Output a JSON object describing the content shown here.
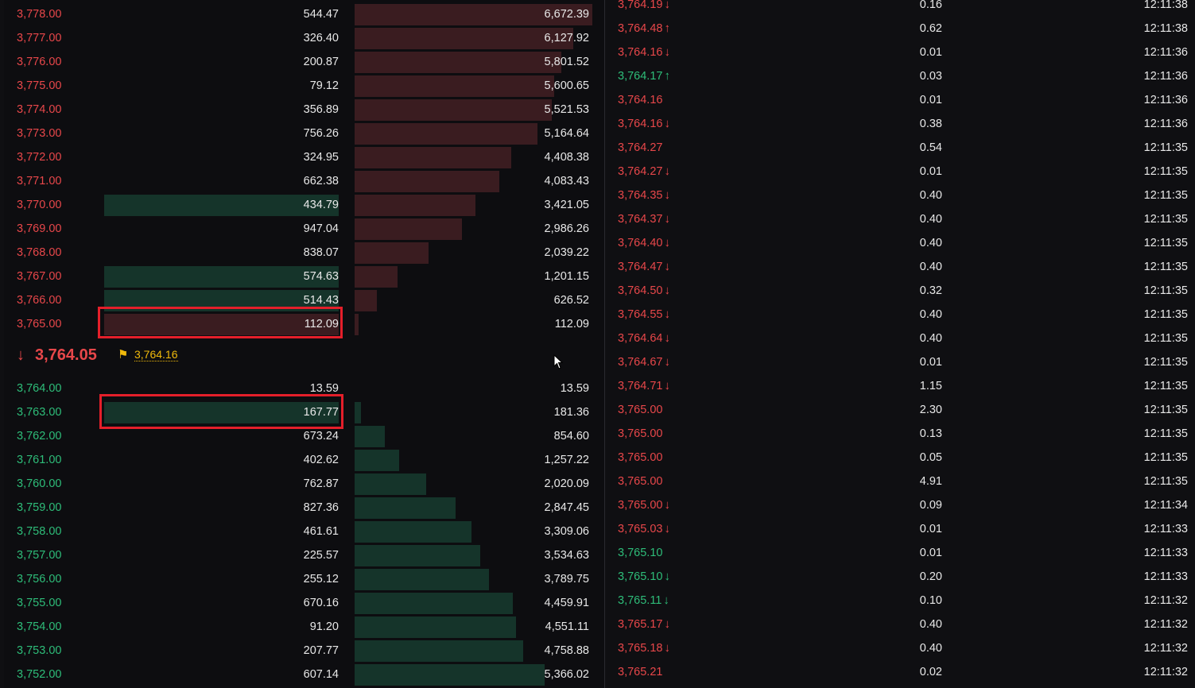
{
  "order_book": {
    "asks": [
      {
        "price": "3,778.00",
        "amount": "544.47",
        "total": "6,672.39",
        "amount_depth": 0,
        "total_depth": 1.0
      },
      {
        "price": "3,777.00",
        "amount": "326.40",
        "total": "6,127.92",
        "amount_depth": 0,
        "total_depth": 0.92
      },
      {
        "price": "3,776.00",
        "amount": "200.87",
        "total": "5,801.52",
        "amount_depth": 0,
        "total_depth": 0.87
      },
      {
        "price": "3,775.00",
        "amount": "79.12",
        "total": "5,600.65",
        "amount_depth": 0,
        "total_depth": 0.84
      },
      {
        "price": "3,774.00",
        "amount": "356.89",
        "total": "5,521.53",
        "amount_depth": 0,
        "total_depth": 0.83
      },
      {
        "price": "3,773.00",
        "amount": "756.26",
        "total": "5,164.64",
        "amount_depth": 0,
        "total_depth": 0.77
      },
      {
        "price": "3,772.00",
        "amount": "324.95",
        "total": "4,408.38",
        "amount_depth": 0,
        "total_depth": 0.66
      },
      {
        "price": "3,771.00",
        "amount": "662.38",
        "total": "4,083.43",
        "amount_depth": 0,
        "total_depth": 0.61
      },
      {
        "price": "3,770.00",
        "amount": "434.79",
        "total": "3,421.05",
        "amount_depth": 1.0,
        "amount_side": "bid",
        "total_depth": 0.51
      },
      {
        "price": "3,769.00",
        "amount": "947.04",
        "total": "2,986.26",
        "amount_depth": 0,
        "total_depth": 0.45
      },
      {
        "price": "3,768.00",
        "amount": "838.07",
        "total": "2,039.22",
        "amount_depth": 0,
        "total_depth": 0.31
      },
      {
        "price": "3,767.00",
        "amount": "574.63",
        "total": "1,201.15",
        "amount_depth": 1.0,
        "amount_side": "bid",
        "total_depth": 0.18
      },
      {
        "price": "3,766.00",
        "amount": "514.43",
        "total": "626.52",
        "amount_depth": 1.0,
        "amount_side": "bid",
        "total_depth": 0.094
      },
      {
        "price": "3,765.00",
        "amount": "112.09",
        "total": "112.09",
        "amount_depth": 1.0,
        "amount_side": "ask",
        "total_depth": 0.017
      }
    ],
    "last_price": {
      "arrow": "↓",
      "value": "3,764.05"
    },
    "mark_price": {
      "icon": "flag-icon",
      "value": "3,764.16"
    },
    "bids": [
      {
        "price": "3,764.00",
        "amount": "13.59",
        "total": "13.59",
        "amount_depth": 0,
        "total_depth": 0
      },
      {
        "price": "3,763.00",
        "amount": "167.77",
        "total": "181.36",
        "amount_depth": 1.0,
        "amount_side": "bid",
        "total_depth": 0.027
      },
      {
        "price": "3,762.00",
        "amount": "673.24",
        "total": "854.60",
        "amount_depth": 0,
        "total_depth": 0.127
      },
      {
        "price": "3,761.00",
        "amount": "402.62",
        "total": "1,257.22",
        "amount_depth": 0,
        "total_depth": 0.187
      },
      {
        "price": "3,760.00",
        "amount": "762.87",
        "total": "2,020.09",
        "amount_depth": 0,
        "total_depth": 0.301
      },
      {
        "price": "3,759.00",
        "amount": "827.36",
        "total": "2,847.45",
        "amount_depth": 0,
        "total_depth": 0.425
      },
      {
        "price": "3,758.00",
        "amount": "461.61",
        "total": "3,309.06",
        "amount_depth": 0,
        "total_depth": 0.493
      },
      {
        "price": "3,757.00",
        "amount": "225.57",
        "total": "3,534.63",
        "amount_depth": 0,
        "total_depth": 0.527
      },
      {
        "price": "3,756.00",
        "amount": "255.12",
        "total": "3,789.75",
        "amount_depth": 0,
        "total_depth": 0.565
      },
      {
        "price": "3,755.00",
        "amount": "670.16",
        "total": "4,459.91",
        "amount_depth": 0,
        "total_depth": 0.665
      },
      {
        "price": "3,754.00",
        "amount": "91.20",
        "total": "4,551.11",
        "amount_depth": 0,
        "total_depth": 0.678
      },
      {
        "price": "3,753.00",
        "amount": "207.77",
        "total": "4,758.88",
        "amount_depth": 0,
        "total_depth": 0.709
      },
      {
        "price": "3,752.00",
        "amount": "607.14",
        "total": "5,366.02",
        "amount_depth": 0,
        "total_depth": 0.8
      }
    ],
    "highlighted": [
      "3,765.00",
      "3,763.00"
    ]
  },
  "trades": [
    {
      "price": "3,764.19",
      "dir": "down",
      "amount": "0.16",
      "time": "12:11:38",
      "side": "sell"
    },
    {
      "price": "3,764.48",
      "dir": "up",
      "amount": "0.62",
      "time": "12:11:38",
      "side": "sell"
    },
    {
      "price": "3,764.16",
      "dir": "down",
      "amount": "0.01",
      "time": "12:11:36",
      "side": "sell"
    },
    {
      "price": "3,764.17",
      "dir": "up",
      "amount": "0.03",
      "time": "12:11:36",
      "side": "buy"
    },
    {
      "price": "3,764.16",
      "dir": "",
      "amount": "0.01",
      "time": "12:11:36",
      "side": "sell"
    },
    {
      "price": "3,764.16",
      "dir": "down",
      "amount": "0.38",
      "time": "12:11:36",
      "side": "sell"
    },
    {
      "price": "3,764.27",
      "dir": "",
      "amount": "0.54",
      "time": "12:11:35",
      "side": "sell"
    },
    {
      "price": "3,764.27",
      "dir": "down",
      "amount": "0.01",
      "time": "12:11:35",
      "side": "sell"
    },
    {
      "price": "3,764.35",
      "dir": "down",
      "amount": "0.40",
      "time": "12:11:35",
      "side": "sell"
    },
    {
      "price": "3,764.37",
      "dir": "down",
      "amount": "0.40",
      "time": "12:11:35",
      "side": "sell"
    },
    {
      "price": "3,764.40",
      "dir": "down",
      "amount": "0.40",
      "time": "12:11:35",
      "side": "sell"
    },
    {
      "price": "3,764.47",
      "dir": "down",
      "amount": "0.40",
      "time": "12:11:35",
      "side": "sell"
    },
    {
      "price": "3,764.50",
      "dir": "down",
      "amount": "0.32",
      "time": "12:11:35",
      "side": "sell"
    },
    {
      "price": "3,764.55",
      "dir": "down",
      "amount": "0.40",
      "time": "12:11:35",
      "side": "sell"
    },
    {
      "price": "3,764.64",
      "dir": "down",
      "amount": "0.40",
      "time": "12:11:35",
      "side": "sell"
    },
    {
      "price": "3,764.67",
      "dir": "down",
      "amount": "0.01",
      "time": "12:11:35",
      "side": "sell"
    },
    {
      "price": "3,764.71",
      "dir": "down",
      "amount": "1.15",
      "time": "12:11:35",
      "side": "sell"
    },
    {
      "price": "3,765.00",
      "dir": "",
      "amount": "2.30",
      "time": "12:11:35",
      "side": "sell"
    },
    {
      "price": "3,765.00",
      "dir": "",
      "amount": "0.13",
      "time": "12:11:35",
      "side": "sell"
    },
    {
      "price": "3,765.00",
      "dir": "",
      "amount": "0.05",
      "time": "12:11:35",
      "side": "sell"
    },
    {
      "price": "3,765.00",
      "dir": "",
      "amount": "4.91",
      "time": "12:11:35",
      "side": "sell"
    },
    {
      "price": "3,765.00",
      "dir": "down",
      "amount": "0.09",
      "time": "12:11:34",
      "side": "sell"
    },
    {
      "price": "3,765.03",
      "dir": "down",
      "amount": "0.01",
      "time": "12:11:33",
      "side": "sell"
    },
    {
      "price": "3,765.10",
      "dir": "",
      "amount": "0.01",
      "time": "12:11:33",
      "side": "buy"
    },
    {
      "price": "3,765.10",
      "dir": "down",
      "amount": "0.20",
      "time": "12:11:33",
      "side": "buy"
    },
    {
      "price": "3,765.11",
      "dir": "down",
      "amount": "0.10",
      "time": "12:11:32",
      "side": "buy"
    },
    {
      "price": "3,765.17",
      "dir": "down",
      "amount": "0.40",
      "time": "12:11:32",
      "side": "sell"
    },
    {
      "price": "3,765.18",
      "dir": "down",
      "amount": "0.40",
      "time": "12:11:32",
      "side": "sell"
    },
    {
      "price": "3,765.21",
      "dir": "",
      "amount": "0.02",
      "time": "12:11:32",
      "side": "sell"
    }
  ],
  "colors": {
    "ask": "#e8474a",
    "bid": "#2ebd79",
    "ask_bar": "#3a1c20",
    "bid_bar": "#15342a",
    "mark": "#f0b90b",
    "highlight": "#e41f2a"
  }
}
